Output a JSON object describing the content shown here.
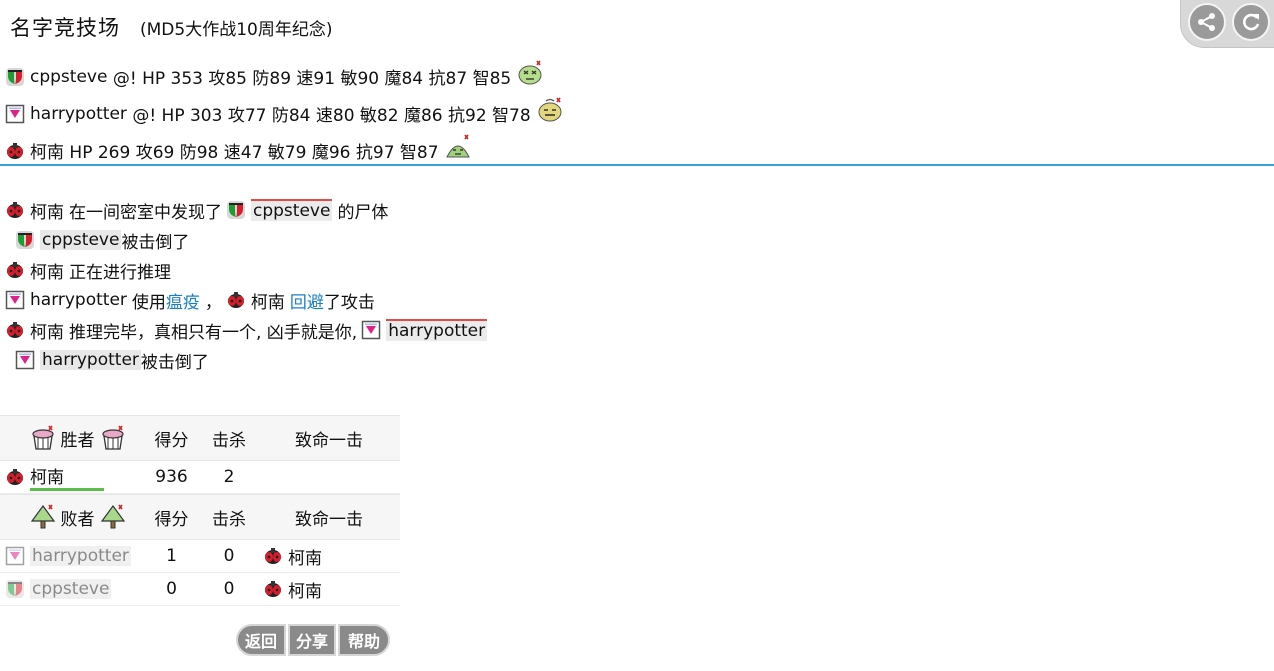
{
  "header": {
    "title": "名字竞技场",
    "subtitle": "(MD5大作战10周年纪念)"
  },
  "corner_buttons": {
    "share_icon": "share-icon",
    "reload_icon": "reload-icon"
  },
  "players": [
    {
      "name": "cppsteve",
      "stats": "@! HP 353 攻85 防89 速91 敏90 魔84 抗87 智85",
      "avatar": "green-red-avatar",
      "status_icon": "dead-face-icon"
    },
    {
      "name": "harrypotter",
      "stats": "@! HP 303 攻77 防84 速80 敏82 魔86 抗92 智78",
      "avatar": "pink-card-avatar",
      "status_icon": "sweat-face-icon"
    },
    {
      "name": "柯南",
      "stats": "HP 269 攻69 防98 速47 敏79 魔96 抗97 智87",
      "avatar": "ladybug-avatar",
      "status_icon": "green-face-icon"
    }
  ],
  "log": {
    "l1": {
      "actor": "柯南",
      "text": "在一间密室中发现了",
      "target": "cppsteve",
      "tail": "的尸体"
    },
    "l2": {
      "name": "cppsteve",
      "text": "被击倒了"
    },
    "l3": {
      "actor": "柯南",
      "text": "正在进行推理"
    },
    "l4": {
      "actor": "harrypotter",
      "text_a": "使用",
      "skill": "瘟疫",
      "text_b": "，",
      "target": "柯南",
      "skill2": "回避",
      "text_c": "了攻击"
    },
    "l5": {
      "actor": "柯南",
      "text": "推理完毕，真相只有一个, 凶手就是你,",
      "target": "harrypotter"
    },
    "l6": {
      "name": "harrypotter",
      "text": "被击倒了"
    }
  },
  "results": {
    "winners_header": {
      "label": "胜者",
      "score": "得分",
      "kills": "击杀",
      "fatal": "致命一击"
    },
    "winners": [
      {
        "name": "柯南",
        "score": "936",
        "kills": "2",
        "fatal": ""
      }
    ],
    "losers_header": {
      "label": "败者",
      "score": "得分",
      "kills": "击杀",
      "fatal": "致命一击"
    },
    "losers": [
      {
        "name": "harrypotter",
        "score": "1",
        "kills": "0",
        "fatal": "柯南"
      },
      {
        "name": "cppsteve",
        "score": "0",
        "kills": "0",
        "fatal": "柯南"
      }
    ]
  },
  "bottom_buttons": {
    "back": "返回",
    "share": "分享",
    "help": "帮助"
  },
  "colors": {
    "separator": "#3aa0d8",
    "skill_link": "#1a7fc8",
    "winner_underline": "#5bbd4a",
    "highlight_bar": "#e84a4a",
    "button_bg": "#8a8a8a"
  }
}
